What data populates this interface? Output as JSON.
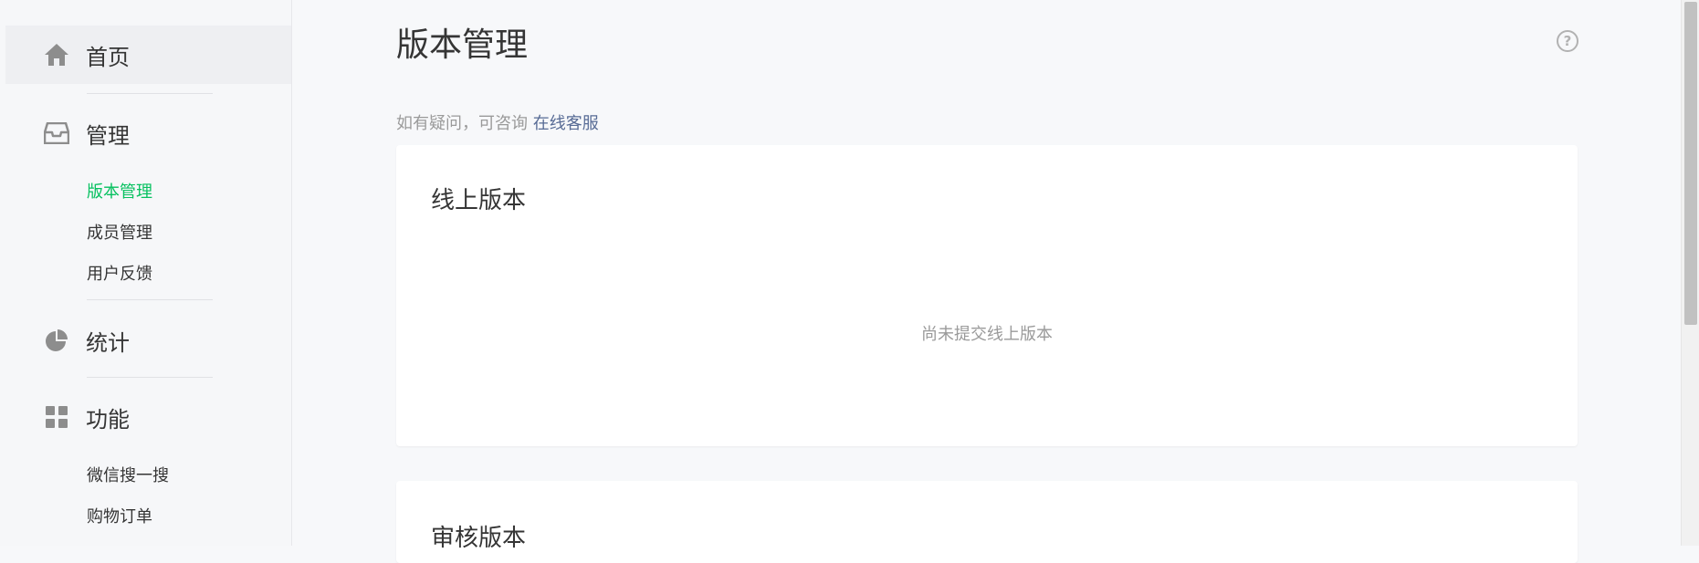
{
  "sidebar": {
    "home": {
      "label": "首页",
      "icon": "home-icon"
    },
    "manage": {
      "label": "管理",
      "icon": "inbox-icon",
      "items": [
        {
          "label": "版本管理",
          "active": true
        },
        {
          "label": "成员管理"
        },
        {
          "label": "用户反馈"
        }
      ]
    },
    "stats": {
      "label": "统计",
      "icon": "pie-chart-icon"
    },
    "features": {
      "label": "功能",
      "icon": "grid-icon",
      "items": [
        {
          "label": "微信搜一搜"
        },
        {
          "label": "购物订单"
        }
      ]
    }
  },
  "main": {
    "title": "版本管理",
    "hint_prefix": "如有疑问，可咨询 ",
    "hint_link": "在线客服",
    "online_card": {
      "title": "线上版本",
      "empty": "尚未提交线上版本"
    },
    "review_card": {
      "title": "审核版本"
    }
  },
  "colors": {
    "accent": "#07c160",
    "link": "#576b95",
    "muted": "#9a9a9a"
  }
}
